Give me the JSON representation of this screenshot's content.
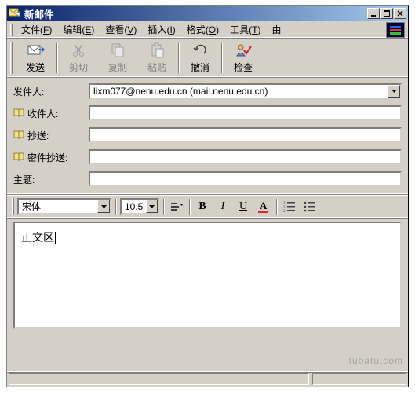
{
  "window": {
    "title": "新邮件"
  },
  "menu": {
    "file": "文件",
    "file_a": "F",
    "edit": "编辑",
    "edit_a": "E",
    "view": "查看",
    "view_a": "V",
    "insert": "插入",
    "insert_a": "I",
    "format": "格式",
    "format_a": "O",
    "tools": "工具",
    "tools_a": "T",
    "more": "由"
  },
  "toolbar": {
    "send": "发送",
    "cut": "剪切",
    "copy": "复制",
    "paste": "粘贴",
    "undo": "撤消",
    "check": "检查"
  },
  "headers": {
    "from_label": "发件人:",
    "from_value": "lixm077@nenu.edu.cn    (mail.nenu.edu.cn)",
    "to_label": "收件人:",
    "to_value": "",
    "cc_label": "抄送:",
    "cc_value": "",
    "bcc_label": "密件抄送:",
    "bcc_value": "",
    "subject_label": "主题:",
    "subject_value": ""
  },
  "formatbar": {
    "font": "宋体",
    "size": "10.5"
  },
  "body": {
    "text": "正文区"
  },
  "watermark": "tubatu.com"
}
